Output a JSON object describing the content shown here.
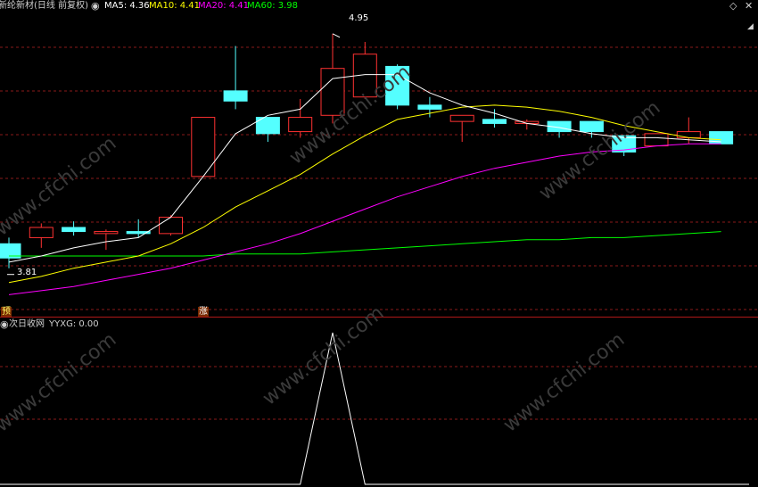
{
  "header": {
    "stock_name": "新纶新材(日线 前复权)",
    "ma5_label": "MA5: 4.36",
    "ma10_label": "MA10: 4.41",
    "ma20_label": "MA20: 4.41",
    "ma60_label": "MA60: 3.98"
  },
  "indicator": {
    "name": "次日收网",
    "value_label": "YYXG: 0.00"
  },
  "markers": {
    "high_label": "4.95",
    "low_label": "3.81",
    "pre_signal": "预",
    "limit_up": "涨"
  },
  "watermark": "www.cfchi.com",
  "colors": {
    "background": "#000000",
    "up": "#ff3232",
    "down": "#54ffff",
    "ma5": "#ffffff",
    "ma10": "#ffff00",
    "ma20": "#ff00ff",
    "ma60": "#00ff00",
    "grid": "#8a1a1a",
    "panel_line": "#ffffff"
  },
  "chart_data": {
    "type": "candlestick",
    "price_range": [
      3.65,
      5.05
    ],
    "candles": [
      {
        "o": 3.92,
        "h": 3.95,
        "l": 3.8,
        "c": 3.85
      },
      {
        "o": 3.95,
        "h": 4.02,
        "l": 3.9,
        "c": 4.0
      },
      {
        "o": 4.0,
        "h": 4.03,
        "l": 3.96,
        "c": 3.98
      },
      {
        "o": 3.97,
        "h": 3.99,
        "l": 3.89,
        "c": 3.98
      },
      {
        "o": 3.98,
        "h": 4.04,
        "l": 3.95,
        "c": 3.97
      },
      {
        "o": 3.97,
        "h": 4.06,
        "l": 3.96,
        "c": 4.05
      },
      {
        "o": 4.25,
        "h": 4.54,
        "l": 4.25,
        "c": 4.54
      },
      {
        "o": 4.67,
        "h": 4.89,
        "l": 4.58,
        "c": 4.62
      },
      {
        "o": 4.54,
        "h": 4.54,
        "l": 4.42,
        "c": 4.46
      },
      {
        "o": 4.47,
        "h": 4.63,
        "l": 4.44,
        "c": 4.54
      },
      {
        "o": 4.55,
        "h": 4.95,
        "l": 4.51,
        "c": 4.78
      },
      {
        "o": 4.64,
        "h": 4.91,
        "l": 4.63,
        "c": 4.85
      },
      {
        "o": 4.79,
        "h": 4.8,
        "l": 4.58,
        "c": 4.6
      },
      {
        "o": 4.6,
        "h": 4.64,
        "l": 4.54,
        "c": 4.58
      },
      {
        "o": 4.52,
        "h": 4.55,
        "l": 4.42,
        "c": 4.55
      },
      {
        "o": 4.53,
        "h": 4.58,
        "l": 4.49,
        "c": 4.51
      },
      {
        "o": 4.51,
        "h": 4.53,
        "l": 4.48,
        "c": 4.52
      },
      {
        "o": 4.52,
        "h": 4.52,
        "l": 4.44,
        "c": 4.47
      },
      {
        "o": 4.52,
        "h": 4.52,
        "l": 4.44,
        "c": 4.47
      },
      {
        "o": 4.45,
        "h": 4.45,
        "l": 4.35,
        "c": 4.37
      },
      {
        "o": 4.4,
        "h": 4.46,
        "l": 4.4,
        "c": 4.46
      },
      {
        "o": 4.44,
        "h": 4.54,
        "l": 4.41,
        "c": 4.47
      },
      {
        "o": 4.47,
        "h": 4.47,
        "l": 4.41,
        "c": 4.41
      }
    ],
    "ma5": [
      3.83,
      3.86,
      3.9,
      3.93,
      3.95,
      4.05,
      4.25,
      4.46,
      4.55,
      4.58,
      4.73,
      4.75,
      4.75,
      4.66,
      4.6,
      4.56,
      4.51,
      4.49,
      4.46,
      4.44,
      4.44,
      4.43,
      4.42
    ],
    "ma10": [
      3.73,
      3.76,
      3.8,
      3.83,
      3.86,
      3.92,
      4.0,
      4.1,
      4.18,
      4.26,
      4.36,
      4.45,
      4.53,
      4.56,
      4.59,
      4.6,
      4.59,
      4.57,
      4.54,
      4.5,
      4.47,
      4.44,
      4.43
    ],
    "ma20": [
      3.67,
      3.69,
      3.71,
      3.74,
      3.77,
      3.8,
      3.84,
      3.88,
      3.92,
      3.97,
      4.03,
      4.09,
      4.15,
      4.2,
      4.25,
      4.29,
      4.32,
      4.35,
      4.37,
      4.38,
      4.4,
      4.41,
      4.41
    ],
    "ma60": [
      3.86,
      3.86,
      3.86,
      3.86,
      3.86,
      3.86,
      3.86,
      3.87,
      3.87,
      3.87,
      3.88,
      3.89,
      3.9,
      3.91,
      3.92,
      3.93,
      3.94,
      3.94,
      3.95,
      3.95,
      3.96,
      3.97,
      3.98
    ],
    "indicator_values": [
      0,
      0,
      0,
      0,
      0,
      0,
      0,
      0,
      0,
      0,
      1,
      0,
      0,
      0,
      0,
      0,
      0,
      0,
      0,
      0,
      0,
      0,
      0
    ],
    "indicator_range": [
      0,
      1
    ]
  }
}
